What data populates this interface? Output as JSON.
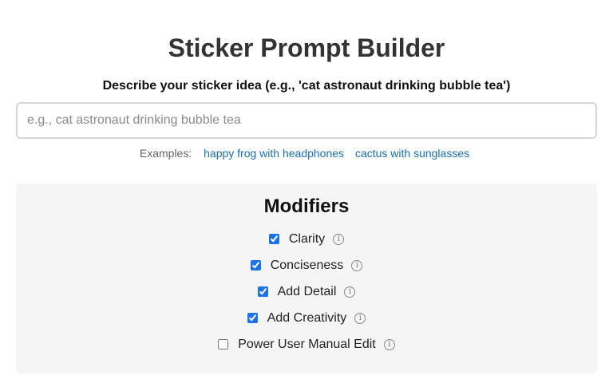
{
  "header": {
    "title": "Sticker Prompt Builder"
  },
  "prompt": {
    "label": "Describe your sticker idea (e.g., 'cat astronaut drinking bubble tea')",
    "placeholder": "e.g., cat astronaut drinking bubble tea",
    "value": ""
  },
  "examples": {
    "label": "Examples:",
    "items": [
      {
        "label": "happy frog with headphones"
      },
      {
        "label": "cactus with sunglasses"
      }
    ]
  },
  "modifiers": {
    "title": "Modifiers",
    "info_icon": "info-circle-icon",
    "items": [
      {
        "label": "Clarity",
        "checked": true
      },
      {
        "label": "Conciseness",
        "checked": true
      },
      {
        "label": "Add Detail",
        "checked": true
      },
      {
        "label": "Add Creativity",
        "checked": true
      },
      {
        "label": "Power User Manual Edit",
        "checked": false
      }
    ]
  },
  "colors": {
    "link": "#1a6fb0",
    "panel_background": "#f5f5f5",
    "checkbox_accent": "#1a73e8"
  }
}
